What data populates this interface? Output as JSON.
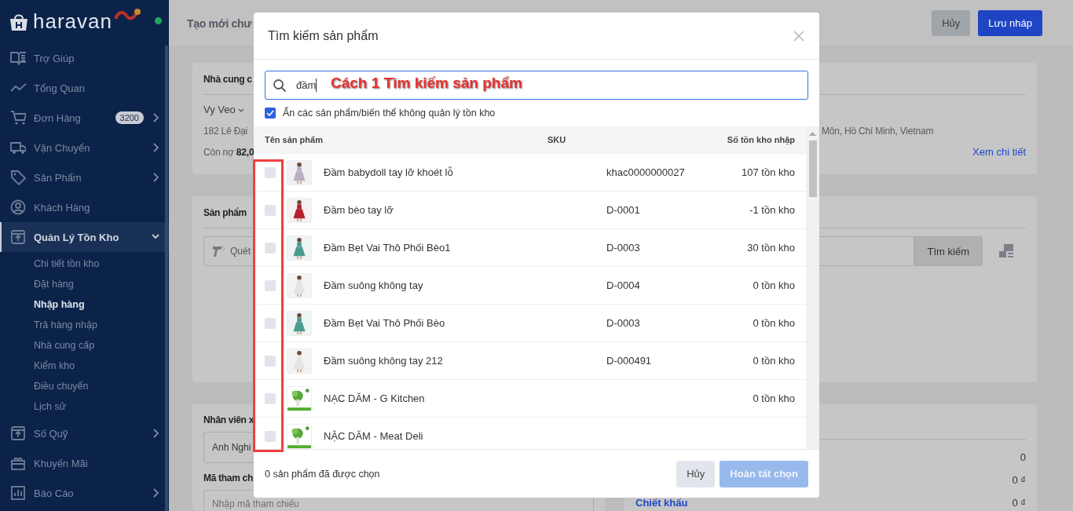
{
  "sidebar": {
    "logo": "haravan",
    "online": true,
    "items": [
      {
        "label": "Trợ Giúp",
        "kind": "link",
        "selected": false
      },
      {
        "label": "Tổng Quan",
        "kind": "link",
        "selected": false
      },
      {
        "label": "Đơn Hàng",
        "kind": "group",
        "badge": "3200",
        "expanded": false,
        "selected": false
      },
      {
        "label": "Vận Chuyển",
        "kind": "group",
        "expanded": false,
        "selected": false
      },
      {
        "label": "Sản Phẩm",
        "kind": "group",
        "expanded": false,
        "selected": false
      },
      {
        "label": "Khách Hàng",
        "kind": "link",
        "selected": false
      },
      {
        "label": "Quản Lý Tồn Kho",
        "kind": "group",
        "expanded": true,
        "selected": true,
        "children": [
          {
            "label": "Chi tiết tồn kho",
            "selected": false
          },
          {
            "label": "Đặt hàng",
            "selected": false
          },
          {
            "label": "Nhập hàng",
            "selected": true
          },
          {
            "label": "Trả hàng nhập",
            "selected": false
          },
          {
            "label": "Nhà cung cấp",
            "selected": false
          },
          {
            "label": "Kiểm kho",
            "selected": false
          },
          {
            "label": "Điều chuyển",
            "selected": false
          },
          {
            "label": "Lịch sử",
            "selected": false
          }
        ]
      },
      {
        "label": "Số Quỹ",
        "kind": "group",
        "expanded": false,
        "selected": false
      },
      {
        "label": "Khuyến Mãi",
        "kind": "link",
        "selected": false
      },
      {
        "label": "Báo Cáo",
        "kind": "group",
        "expanded": false,
        "selected": false
      }
    ]
  },
  "header": {
    "title": "Tạo mới chư",
    "buttons": [
      {
        "label": "Hủy",
        "kind": "secondary"
      },
      {
        "label": "Lưu nháp",
        "kind": "primary"
      }
    ]
  },
  "supplier_card": {
    "title": "Nhà cung c",
    "name": "Vy Veo",
    "address": "182 Lê Đại",
    "address_end": "Môn, Hồ Chí Minh, Vietnam",
    "debt": "Còn nợ **82,0**",
    "link": "Xem chi tiết"
  },
  "products_card": {
    "title": "Sản phẩm",
    "scan_placeholder": "Quét",
    "search_button": "Tìm kiếm"
  },
  "staff_card": {
    "title": "Nhân viên x",
    "staff": "Anh Nghi",
    "ref_label": "Mã tham ch",
    "ref_placeholder": "Nhập mã tham chiếu"
  },
  "totals_card": {
    "rows": [
      {
        "value": "0"
      },
      {
        "value": "0 ₫"
      },
      {
        "label": "Chiết khấu",
        "value": "0 ₫"
      }
    ]
  },
  "modal": {
    "title": "Tìm kiếm sản phẩm",
    "search_value": "đầm",
    "callout": "Cách 1 Tìm kiếm sản phẩm",
    "hide_option": {
      "label": "Ẩn các sản phẩm/biến thể không quản lý tồn kho",
      "checked": true
    },
    "columns": [
      "Tên sản phẩm",
      "SKU",
      "Số tồn kho nhập"
    ],
    "rows": [
      {
        "name": "Đầm babydoll tay lỡ khoét lỗ",
        "sku": "khac0000000027",
        "stock": "107 tồn kho",
        "checked": false
      },
      {
        "name": "Đầm bèo tay lỡ",
        "sku": "D-0001",
        "stock": "-1 tồn kho",
        "checked": false
      },
      {
        "name": "Đầm Bẹt Vai Thô Phối Bèo1",
        "sku": "D-0003",
        "stock": "30 tồn kho",
        "checked": false
      },
      {
        "name": "Đầm suông không tay",
        "sku": "D-0004",
        "stock": "0 tồn kho",
        "checked": false
      },
      {
        "name": "Đầm Bẹt Vai Thô Phối Bèo",
        "sku": "D-0003",
        "stock": "0 tồn kho",
        "checked": false
      },
      {
        "name": "Đầm suông không tay 212",
        "sku": "D-000491",
        "stock": "0 tồn kho",
        "checked": false
      },
      {
        "name": "NẠC DĂM - G Kitchen",
        "stock": "0 tồn kho",
        "checked": false
      },
      {
        "name": "NẶC DĂM - Meat Deli",
        "checked": false
      }
    ],
    "footer_text": "0 sản phẩm đã được chọn",
    "buttons": [
      {
        "label": "Hủy",
        "kind": "secondary",
        "disabled": false
      },
      {
        "label": "Hoàn tất chọn",
        "kind": "primary",
        "disabled": true
      }
    ]
  }
}
